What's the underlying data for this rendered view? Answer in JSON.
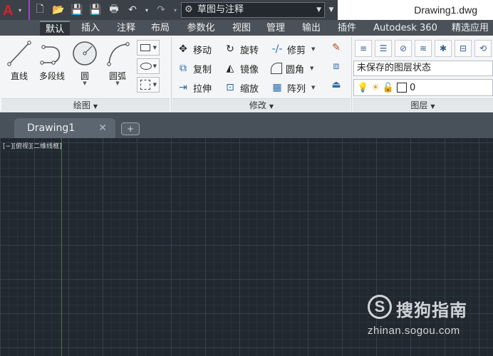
{
  "app": {
    "logo_letter": "A",
    "document_title": "Drawing1.dwg"
  },
  "quick_access": {
    "workspace": "草图与注释"
  },
  "ribbon_tabs": [
    "默认",
    "插入",
    "注释",
    "布局",
    "参数化",
    "视图",
    "管理",
    "输出",
    "插件",
    "Autodesk 360",
    "精选应用"
  ],
  "draw_panel": {
    "label": "绘图",
    "tools": [
      {
        "label": "直线",
        "icon": "line-icon"
      },
      {
        "label": "多段线",
        "icon": "polyline-icon"
      },
      {
        "label": "圆",
        "icon": "circle-icon"
      },
      {
        "label": "圆弧",
        "icon": "arc-icon"
      }
    ]
  },
  "modify_panel": {
    "label": "修改",
    "tools": [
      {
        "label": "移动",
        "icon": "move-icon"
      },
      {
        "label": "旋转",
        "icon": "rotate-icon"
      },
      {
        "label": "修剪",
        "icon": "trim-icon"
      },
      {
        "label": "复制",
        "icon": "copy-icon"
      },
      {
        "label": "镜像",
        "icon": "mirror-icon"
      },
      {
        "label": "圆角",
        "icon": "fillet-icon"
      },
      {
        "label": "拉伸",
        "icon": "stretch-icon"
      },
      {
        "label": "缩放",
        "icon": "scale-icon"
      },
      {
        "label": "阵列",
        "icon": "array-icon"
      }
    ]
  },
  "layers_panel": {
    "label": "图层",
    "layer_state": "未保存的图层状态",
    "current_layer": "0"
  },
  "document_tabs": [
    {
      "label": "Drawing1"
    }
  ],
  "viewport": {
    "label": "[−][俯视][二维线框]"
  },
  "watermark": {
    "logo": "S",
    "brand": "搜狗指南",
    "url": "zhinan.sogou.com"
  },
  "colors": {
    "accent_highlight": "#9b45c8",
    "canvas_bg": "#212830",
    "ribbon_bg": "#f4f5f6",
    "logo_red": "#d3222a"
  }
}
